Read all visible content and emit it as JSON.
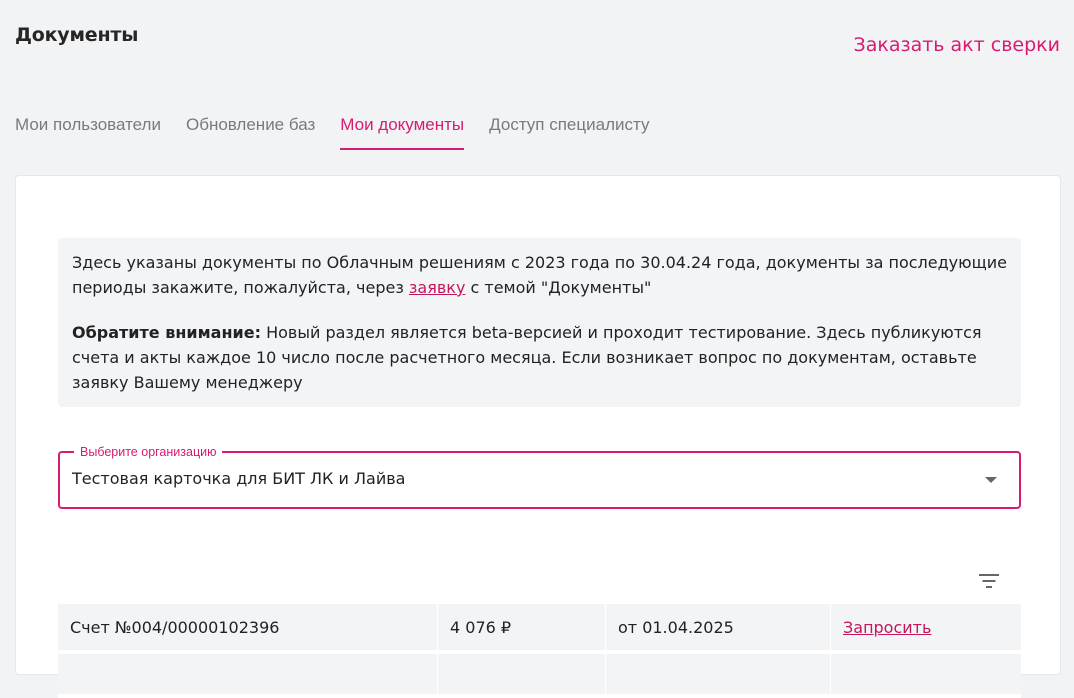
{
  "header": {
    "title": "Документы",
    "order_act_link": "Заказать акт сверки"
  },
  "tabs": [
    {
      "label": "Мои пользователи",
      "active": false
    },
    {
      "label": "Обновление баз",
      "active": false
    },
    {
      "label": "Мои документы",
      "active": true
    },
    {
      "label": "Доступ специалисту",
      "active": false
    }
  ],
  "info": {
    "p1_before": "Здесь указаны документы по Облачным решениям с 2023 года по 30.04.24 года, документы за последующие периоды закажите, пожалуйста, через ",
    "p1_link": "заявку",
    "p1_after": " с темой \"Документы\"",
    "p2_bold": "Обратите внимание:",
    "p2_text": " Новый раздел является beta-версией и проходит тестирование. Здесь публикуются счета и акты каждое 10 число после расчетного месяца. Если возникает вопрос по документам, оставьте заявку Вашему менеджеру"
  },
  "organization_select": {
    "label": "Выберите организацию",
    "value": "Тестовая карточка для БИТ ЛК и Лайва"
  },
  "documents": [
    {
      "name": "Счет №004/00000102396",
      "amount": "4 076 ₽",
      "date": "от 01.04.2025",
      "action": "Запросить"
    }
  ],
  "colors": {
    "accent": "#d81b72",
    "background": "#f2f3f5",
    "card": "#ffffff",
    "info_bg": "#f3f4f6"
  },
  "icons": {
    "filter": "filter-icon",
    "dropdown": "chevron-down-icon"
  }
}
